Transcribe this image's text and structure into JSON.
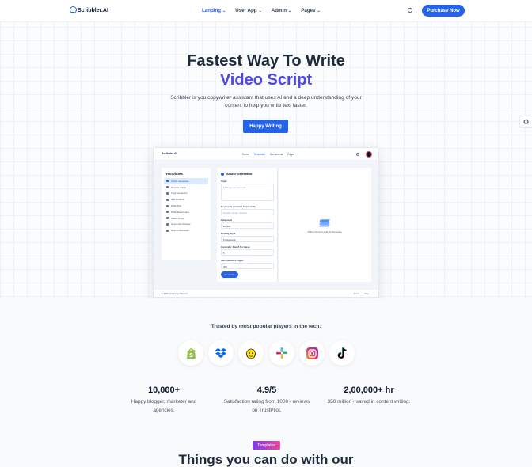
{
  "nav": {
    "logo_text": "Scribbler.AI",
    "menu": [
      {
        "label": "Landing"
      },
      {
        "label": "User App"
      },
      {
        "label": "Admin"
      },
      {
        "label": "Pages"
      }
    ],
    "cta_label": "Purchase Now"
  },
  "hero": {
    "title_line1": "Fastest Way To Write",
    "title_line2": "Video Script",
    "subtitle": "Scribbler is you copywriter assistant that uses AI and a deep understanding of your content to help you write text faster.",
    "cta_label": "Happy Writing"
  },
  "mockup": {
    "logo_text": "Scribbler.AI",
    "menu": [
      "Home",
      "Templates",
      "Documents",
      "Pages"
    ],
    "sidebar_title": "Templates",
    "sidebar_items": [
      "Article Generator",
      "Rewrite Article",
      "Tags Generator",
      "Ads Content",
      "Write Title",
      "Write Description",
      "Video Script",
      "Grammar Checker",
      "How to Generate"
    ],
    "form_title": "Article Generator",
    "topic_label": "Topic",
    "topic_placeholder": "10 things new and cars",
    "keywords_label": "Keywords (Comma Separated)",
    "keywords_placeholder": "Novella, Nicole, Content",
    "language_label": "Language",
    "language_value": "English",
    "style_label": "Writing Style",
    "style_value": "Professional",
    "generate_label": "Generate: Max 8 for these",
    "generate_value": "5",
    "maxlen_label": "Max Results Length",
    "maxlen_value": "200",
    "button_label": "Generate",
    "output_text": "Filling the form and hit Generate.",
    "footer_left": "© 2025, Crafted by Themesh",
    "footer_links": [
      "Terms",
      "Help"
    ]
  },
  "trusted": {
    "title": "Trusted by most popular players in the tech.",
    "brands": [
      "shopify-icon",
      "dropbox-icon",
      "mailchimp-icon",
      "slack-icon",
      "instagram-icon",
      "tiktok-icon"
    ]
  },
  "stats": [
    {
      "value": "10,000+",
      "line1": "Happy blogger, marketer and",
      "line2": "agencies."
    },
    {
      "value": "4.9/5",
      "line1": "Satisfaction rating from 1000+ reviews",
      "line2": "on TrustPilot."
    },
    {
      "value": "2,00,000+ hr",
      "line1": "$50 million+ saved in content writing.",
      "line2": ""
    }
  ],
  "section": {
    "badge": "Templates",
    "title": "Things you can do with our"
  }
}
